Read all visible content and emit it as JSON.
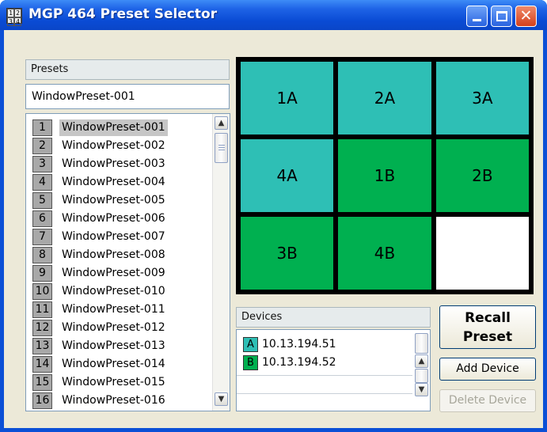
{
  "window": {
    "title": "MGP 464 Preset Selector",
    "icon_digits": [
      "1",
      "2",
      "3",
      "4"
    ],
    "minimize_icon": "minimize-icon",
    "maximize_icon": "maximize-icon",
    "close_icon": "close-icon",
    "close_glyph": "✕"
  },
  "presets": {
    "header": "Presets",
    "current_value": "WindowPreset-001",
    "selected_index": 0,
    "items": [
      {
        "num": "1",
        "name": "WindowPreset-001"
      },
      {
        "num": "2",
        "name": "WindowPreset-002"
      },
      {
        "num": "3",
        "name": "WindowPreset-003"
      },
      {
        "num": "4",
        "name": "WindowPreset-004"
      },
      {
        "num": "5",
        "name": "WindowPreset-005"
      },
      {
        "num": "6",
        "name": "WindowPreset-006"
      },
      {
        "num": "7",
        "name": "WindowPreset-007"
      },
      {
        "num": "8",
        "name": "WindowPreset-008"
      },
      {
        "num": "9",
        "name": "WindowPreset-009"
      },
      {
        "num": "10",
        "name": "WindowPreset-010"
      },
      {
        "num": "11",
        "name": "WindowPreset-011"
      },
      {
        "num": "12",
        "name": "WindowPreset-012"
      },
      {
        "num": "13",
        "name": "WindowPreset-013"
      },
      {
        "num": "14",
        "name": "WindowPreset-014"
      },
      {
        "num": "15",
        "name": "WindowPreset-015"
      },
      {
        "num": "16",
        "name": "WindowPreset-016"
      }
    ],
    "scroll_up_icon": "scroll-up-arrow-icon",
    "scroll_down_icon": "scroll-down-arrow-icon"
  },
  "layout": {
    "cells": [
      {
        "label": "1A",
        "color": "#2ebfb5"
      },
      {
        "label": "2A",
        "color": "#2ebfb5"
      },
      {
        "label": "3A",
        "color": "#2ebfb5"
      },
      {
        "label": "4A",
        "color": "#2ebfb5"
      },
      {
        "label": "1B",
        "color": "#00b050"
      },
      {
        "label": "2B",
        "color": "#00b050"
      },
      {
        "label": "3B",
        "color": "#00b050"
      },
      {
        "label": "4B",
        "color": "#00b050"
      },
      {
        "label": "",
        "color": "#ffffff"
      }
    ]
  },
  "devices": {
    "header": "Devices",
    "items": [
      {
        "tag": "A",
        "ip": "10.13.194.51",
        "color": "#2ebfb5"
      },
      {
        "tag": "B",
        "ip": "10.13.194.52",
        "color": "#00b050"
      }
    ]
  },
  "buttons": {
    "recall_line1": "Recall",
    "recall_line2": "Preset",
    "add_device": "Add Device",
    "delete_device": "Delete Device",
    "delete_device_enabled": false
  },
  "colors": {
    "titlebar": "#0a4bd4",
    "client_bg": "#ece9d8",
    "group_a": "#2ebfb5",
    "group_b": "#00b050"
  }
}
